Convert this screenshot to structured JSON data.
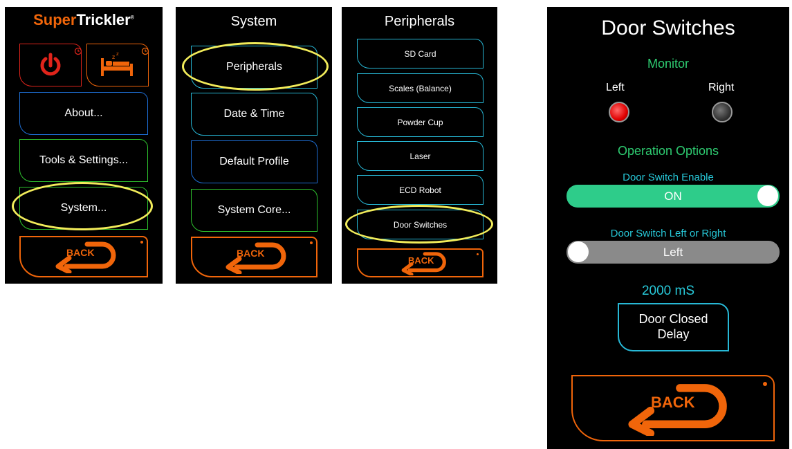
{
  "main": {
    "logo_super": "Super",
    "logo_trickler": "Trickler",
    "logo_mark": "®",
    "about": "About...",
    "tools": "Tools & Settings...",
    "system": "System...",
    "back": "BACK"
  },
  "system": {
    "title": "System",
    "peripherals": "Peripherals",
    "datetime": "Date & Time",
    "default_profile": "Default Profile",
    "system_core": "System Core...",
    "back": "BACK"
  },
  "peripherals": {
    "title": "Peripherals",
    "items": [
      "SD Card",
      "Scales (Balance)",
      "Powder Cup",
      "Laser",
      "ECD Robot",
      "Door Switches"
    ],
    "back": "BACK"
  },
  "door": {
    "title": "Door Switches",
    "monitor": "Monitor",
    "left": "Left",
    "right": "Right",
    "left_state": "red",
    "right_state": "grey",
    "operation_options": "Operation Options",
    "enable_label": "Door Switch Enable",
    "enable_value": "ON",
    "side_label": "Door Switch Left or Right",
    "side_value": "Left",
    "delay_value": "2000 mS",
    "delay_button": "Door Closed Delay",
    "back": "BACK"
  },
  "colors": {
    "orange": "#f0650a",
    "green_text": "#2ecc71",
    "cyan_text": "#27c8d8",
    "highlight": "#f2ec5a"
  }
}
